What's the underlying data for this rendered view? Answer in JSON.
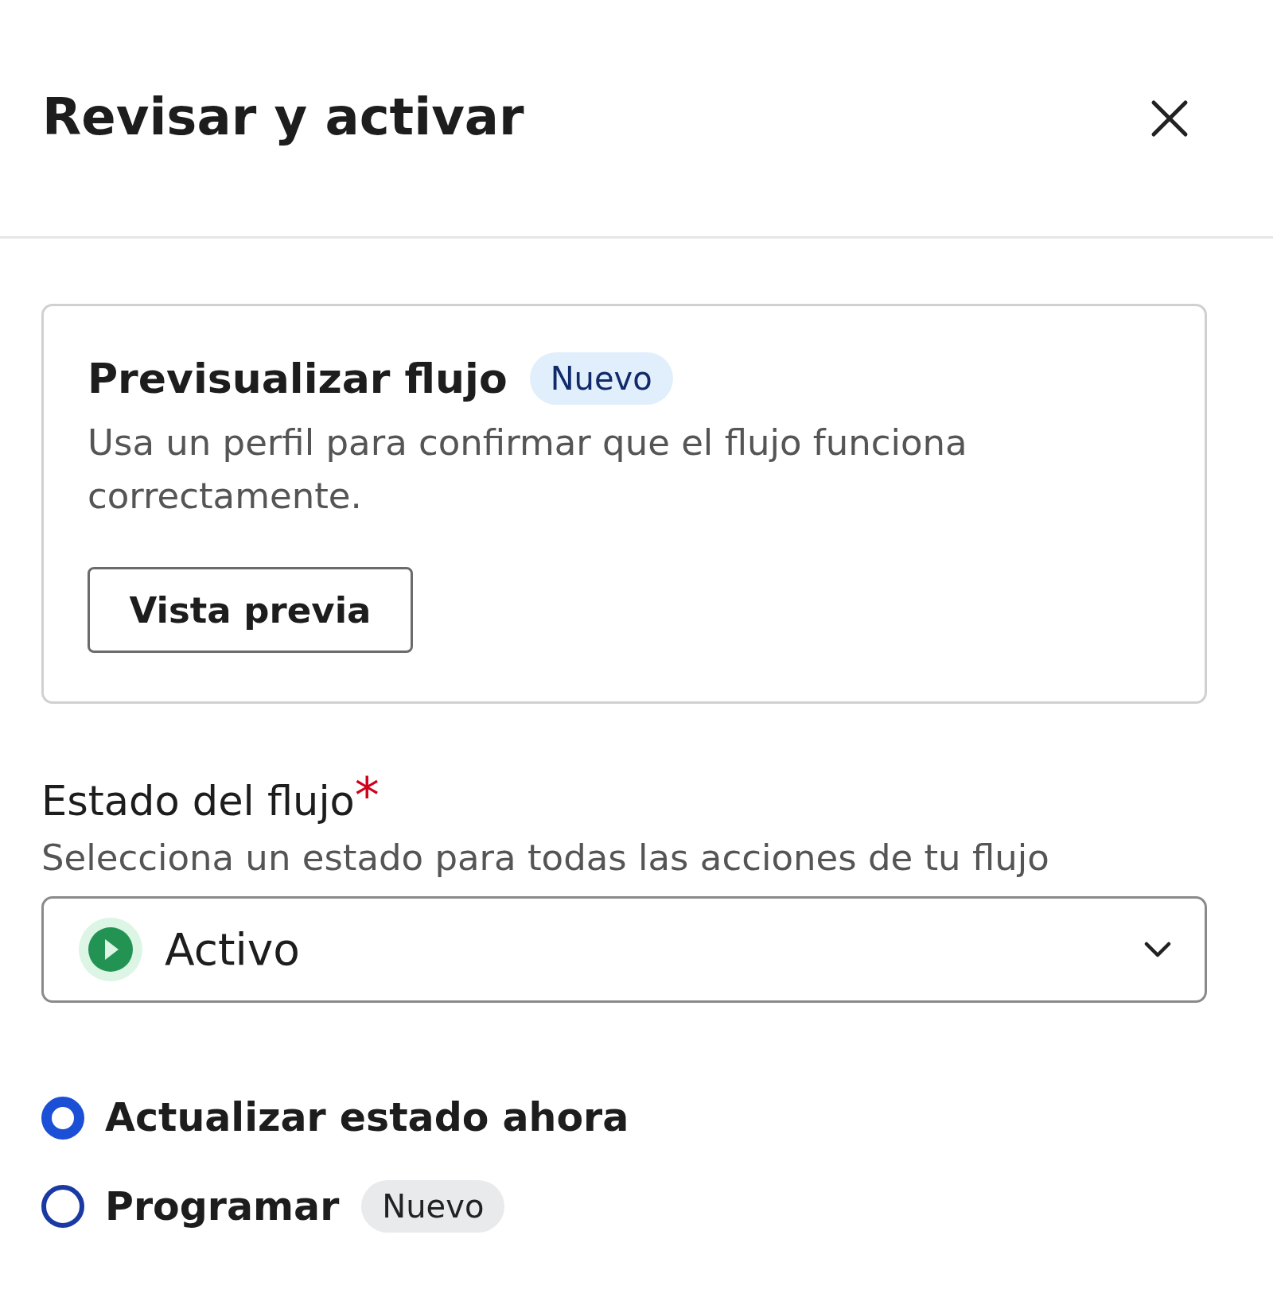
{
  "header": {
    "title": "Revisar y activar"
  },
  "preview_card": {
    "title": "Previsualizar flujo",
    "badge": "Nuevo",
    "description": "Usa un perfil para confirmar que el flujo funciona correctamente.",
    "button": "Vista previa"
  },
  "status_field": {
    "label": "Estado del flujo",
    "required": true,
    "required_mark": "*",
    "help": "Selecciona un estado para todas las acciones de tu flujo",
    "value": "Activo"
  },
  "options": [
    {
      "label": "Actualizar estado ahora",
      "selected": true
    },
    {
      "label": "Programar",
      "selected": false,
      "badge": "Nuevo"
    }
  ]
}
